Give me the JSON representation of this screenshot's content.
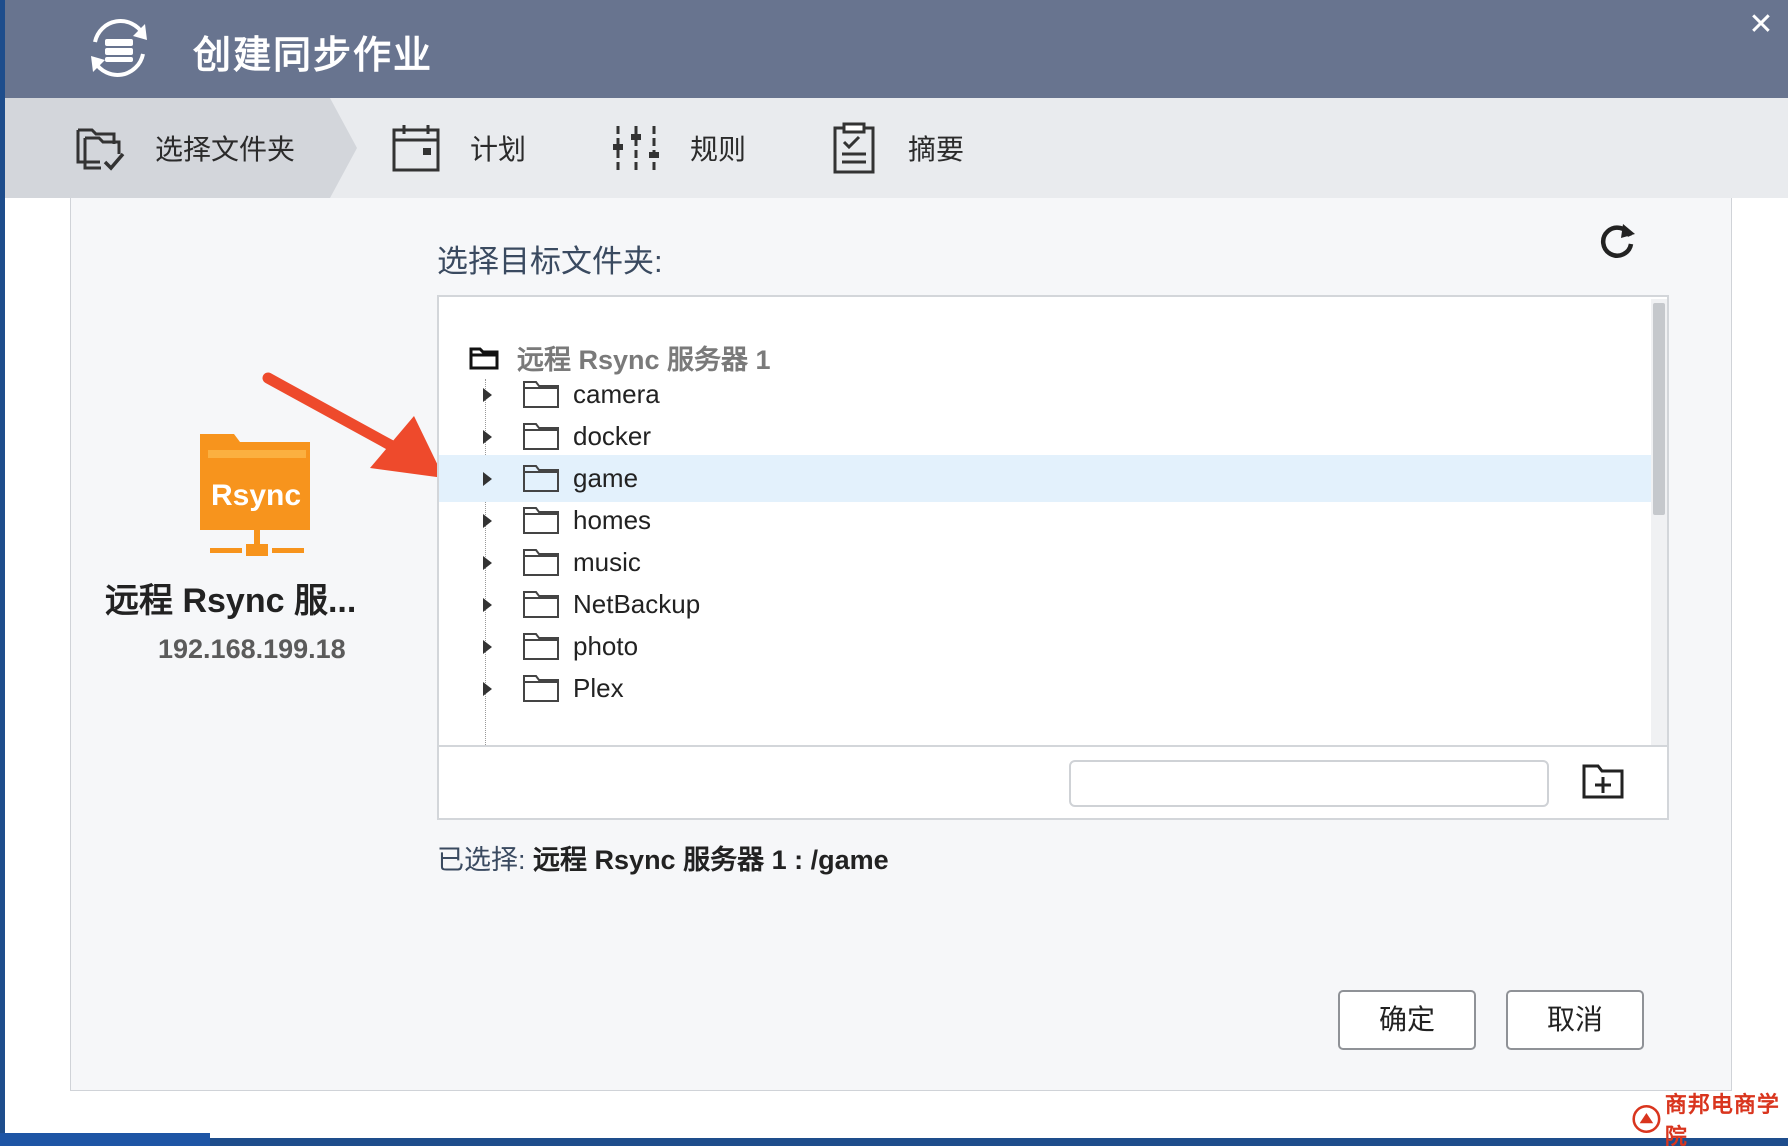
{
  "window": {
    "title": "创建同步作业",
    "close_glyph": "✕"
  },
  "steps": [
    {
      "label": "选择文件夹",
      "icon": "folder-check-icon",
      "active": true
    },
    {
      "label": "计划",
      "icon": "calendar-icon",
      "active": false
    },
    {
      "label": "规则",
      "icon": "sliders-icon",
      "active": false
    },
    {
      "label": "摘要",
      "icon": "clipboard-icon",
      "active": false
    }
  ],
  "source": {
    "logo_text": "Rsync",
    "name": "远程 Rsync 服...",
    "ip": "192.168.199.18"
  },
  "target": {
    "label": "选择目标文件夹:",
    "root": "远程 Rsync 服务器 1",
    "folders": [
      "camera",
      "docker",
      "game",
      "homes",
      "music",
      "NetBackup",
      "photo",
      "Plex"
    ],
    "selected_folder": "game",
    "new_folder_value": ""
  },
  "selection": {
    "prefix": "已选择:",
    "value": "远程 Rsync 服务器 1 : /game"
  },
  "buttons": {
    "ok": "确定",
    "cancel": "取消"
  },
  "watermark": {
    "text": "商邦电商学院"
  },
  "colors": {
    "titlebar": "#68748f",
    "accent_orange": "#f7941d",
    "arrow_red": "#ee4a2c",
    "selected_row": "#e3f1fc"
  }
}
